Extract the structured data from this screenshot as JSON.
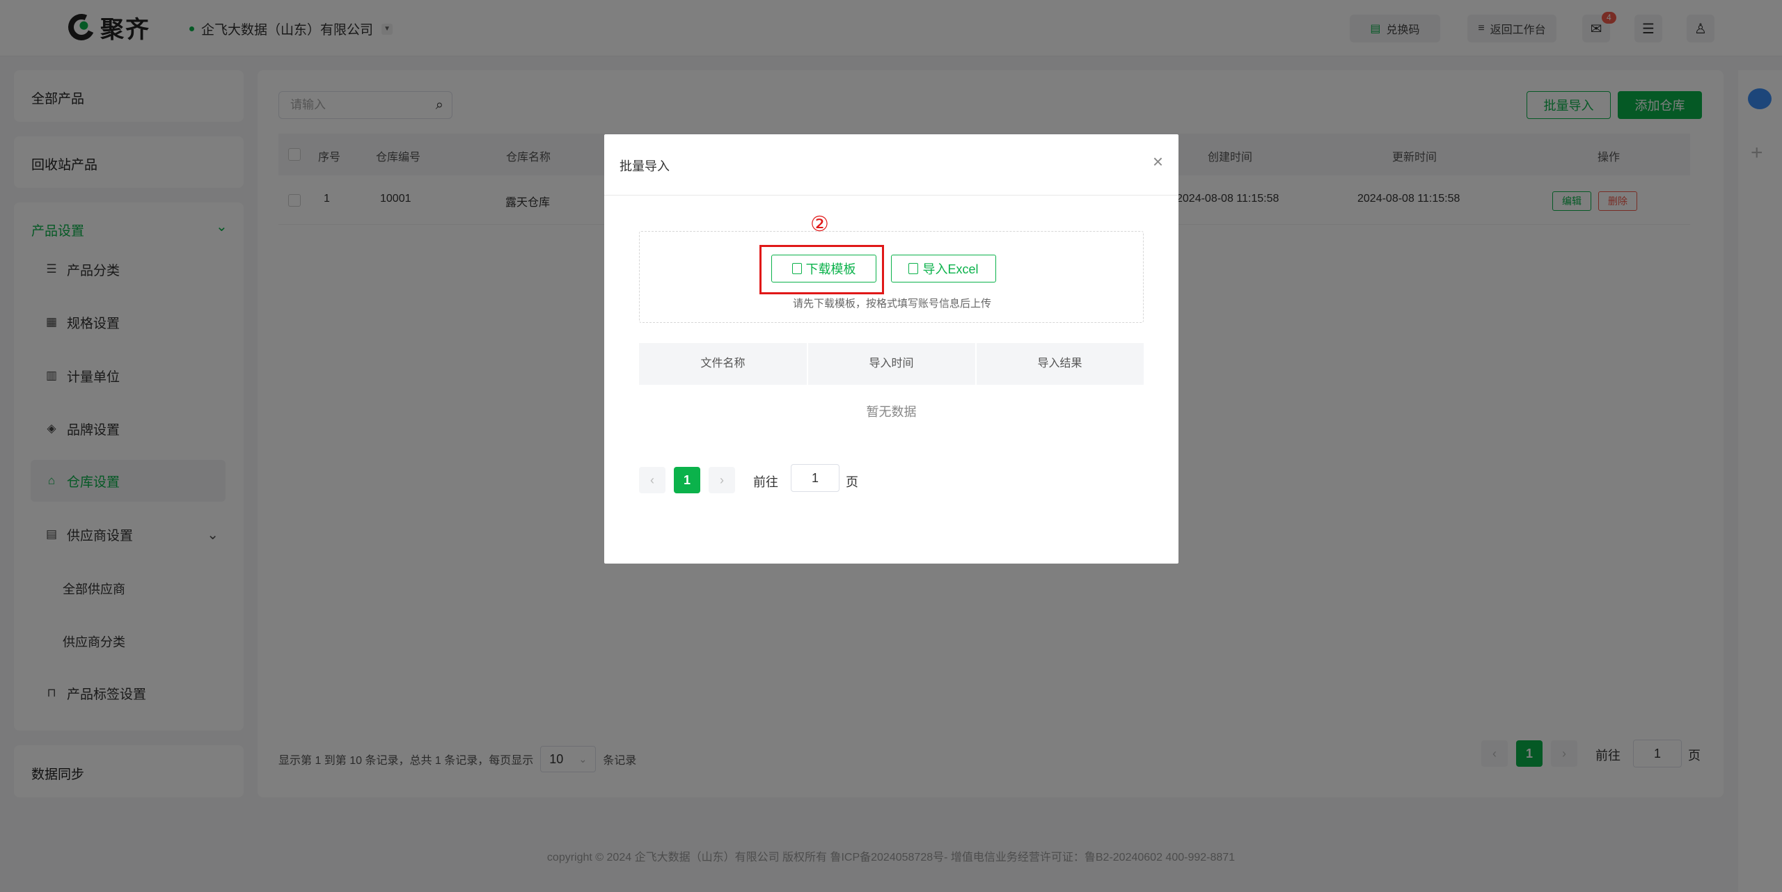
{
  "header": {
    "logo_text": "聚齐",
    "company": "企飞大数据（山东）有限公司",
    "redeem_label": "兑换码",
    "workbench_label": "返回工作台",
    "mail_badge": "4"
  },
  "sidebar": {
    "all_products": "全部产品",
    "recycle_products": "回收站产品",
    "product_settings": "产品设置",
    "items": [
      {
        "label": "产品分类",
        "icon": "list-icon"
      },
      {
        "label": "规格设置",
        "icon": "spec-icon"
      },
      {
        "label": "计量单位",
        "icon": "unit-icon"
      },
      {
        "label": "品牌设置",
        "icon": "tag-icon"
      },
      {
        "label": "仓库设置",
        "icon": "warehouse-icon"
      },
      {
        "label": "供应商设置",
        "icon": "supplier-icon"
      }
    ],
    "supplier_sub": [
      "全部供应商",
      "供应商分类"
    ],
    "tag_settings": "产品标签设置",
    "data_sync": "数据同步"
  },
  "main": {
    "search_placeholder": "请输入",
    "batch_import": "批量导入",
    "add_warehouse": "添加仓库",
    "columns": [
      "序号",
      "仓库编号",
      "仓库名称",
      "创建时间",
      "更新时间",
      "操作"
    ],
    "rows": [
      {
        "index": "1",
        "code": "10001",
        "name": "露天仓库",
        "created": "2024-08-08 11:15:58",
        "updated": "2024-08-08 11:15:58",
        "edit": "编辑",
        "delete": "删除"
      }
    ],
    "footer_prefix": "显示第 1 到第 10 条记录，总共 1 条记录，每页显示",
    "page_size": "10",
    "footer_suffix": "条记录",
    "current_page": "1",
    "goto_label": "前往",
    "goto_value": "1",
    "page_unit": "页"
  },
  "copyright": "copyright © 2024 企飞大数据（山东）有限公司 版权所有   鲁ICP备2024058728号-   增值电信业务经营许可证：鲁B2-20240602   400-992-8871",
  "modal": {
    "title": "批量导入",
    "download_label": "下载模板",
    "import_label": "导入Excel",
    "hint": "请先下载模板，按格式填写账号信息后上传",
    "columns": [
      "文件名称",
      "导入时间",
      "导入结果"
    ],
    "empty": "暂无数据",
    "current_page": "1",
    "goto_label": "前往",
    "goto_value": "1",
    "page_unit": "页",
    "step_marker": "②"
  },
  "colors": {
    "accent": "#0bb24b",
    "annotation": "#e01818"
  }
}
